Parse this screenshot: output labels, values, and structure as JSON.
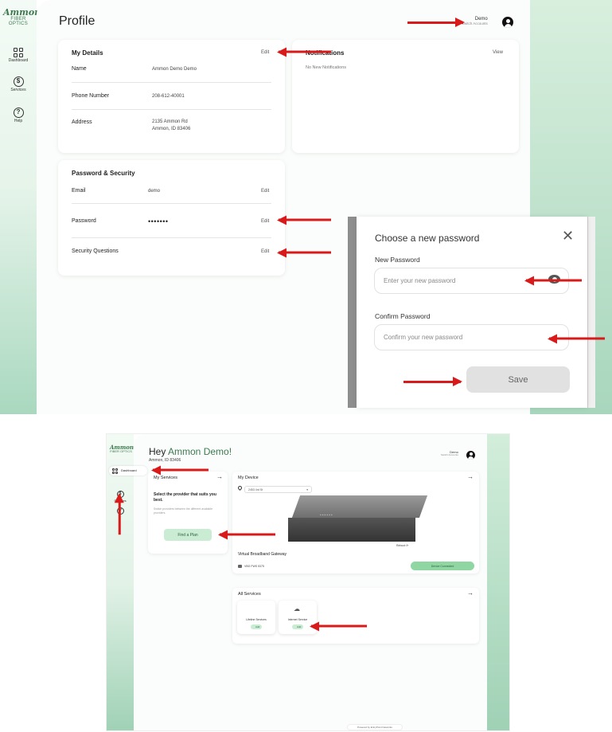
{
  "profile": {
    "logo": {
      "line1": "Ammon",
      "line2": "FIBER OPTICS"
    },
    "nav": [
      {
        "label": "Dashboard"
      },
      {
        "label": "Services"
      },
      {
        "label": "Help"
      }
    ],
    "title": "Profile",
    "account": {
      "name": "Demo",
      "switch": "Switch Accounts"
    },
    "my_details": {
      "title": "My Details",
      "edit": "Edit",
      "rows": [
        {
          "label": "Name",
          "value": "Ammon Demo Demo"
        },
        {
          "label": "Phone Number",
          "value": "208-612-40001"
        },
        {
          "label": "Address",
          "value_line1": "2135 Ammon Rd",
          "value_line2": "Ammon, ID 83406"
        }
      ]
    },
    "notifications": {
      "title": "Notifications",
      "view": "View",
      "empty": "No New Notifications"
    },
    "security": {
      "title": "Password & Security",
      "rows": [
        {
          "label": "Email",
          "value": "demo",
          "edit": "Edit"
        },
        {
          "label": "Password",
          "value": "•••••••",
          "edit": "Edit"
        },
        {
          "label": "Security Questions",
          "value": "",
          "edit": "Edit"
        }
      ]
    }
  },
  "modal": {
    "title": "Choose a new password",
    "new_label": "New Password",
    "new_placeholder": "Enter your new password",
    "confirm_label": "Confirm Password",
    "confirm_placeholder": "Confirm your new password",
    "save": "Save"
  },
  "dashboard": {
    "logo": {
      "line1": "Ammon",
      "line2": "FIBER OPTICS"
    },
    "nav_dashboard": "Dashboard",
    "nav_services": "Services",
    "greeting_prefix": "Hey ",
    "greeting_name": "Ammon Demo!",
    "address": "Ammon, ID 83406",
    "account": {
      "name": "Demo",
      "switch": "Switch Accounts"
    },
    "my_services": {
      "title": "My Services",
      "heading": "Select the provider that suits you best.",
      "sub": "Switch providers between the different available providers.",
      "button": "Find a Plan"
    },
    "device": {
      "title": "My Device",
      "location": "2453 4rd St",
      "reboot": "Reboot",
      "name": "Virtual Broadband Gateway",
      "id": "VBG FWS 5375",
      "status": "Device Connected"
    },
    "all_services": {
      "title": "All Services",
      "tiles": [
        {
          "label": "Lifeline Services",
          "button": "Add"
        },
        {
          "label": "Internet Service",
          "button": "Add"
        }
      ]
    },
    "footer": "Powered by EntryPoint Networks"
  },
  "colors": {
    "accent": "#3d7a4f",
    "arrow": "#d91a1a",
    "green_button": "#8fd6a3"
  }
}
